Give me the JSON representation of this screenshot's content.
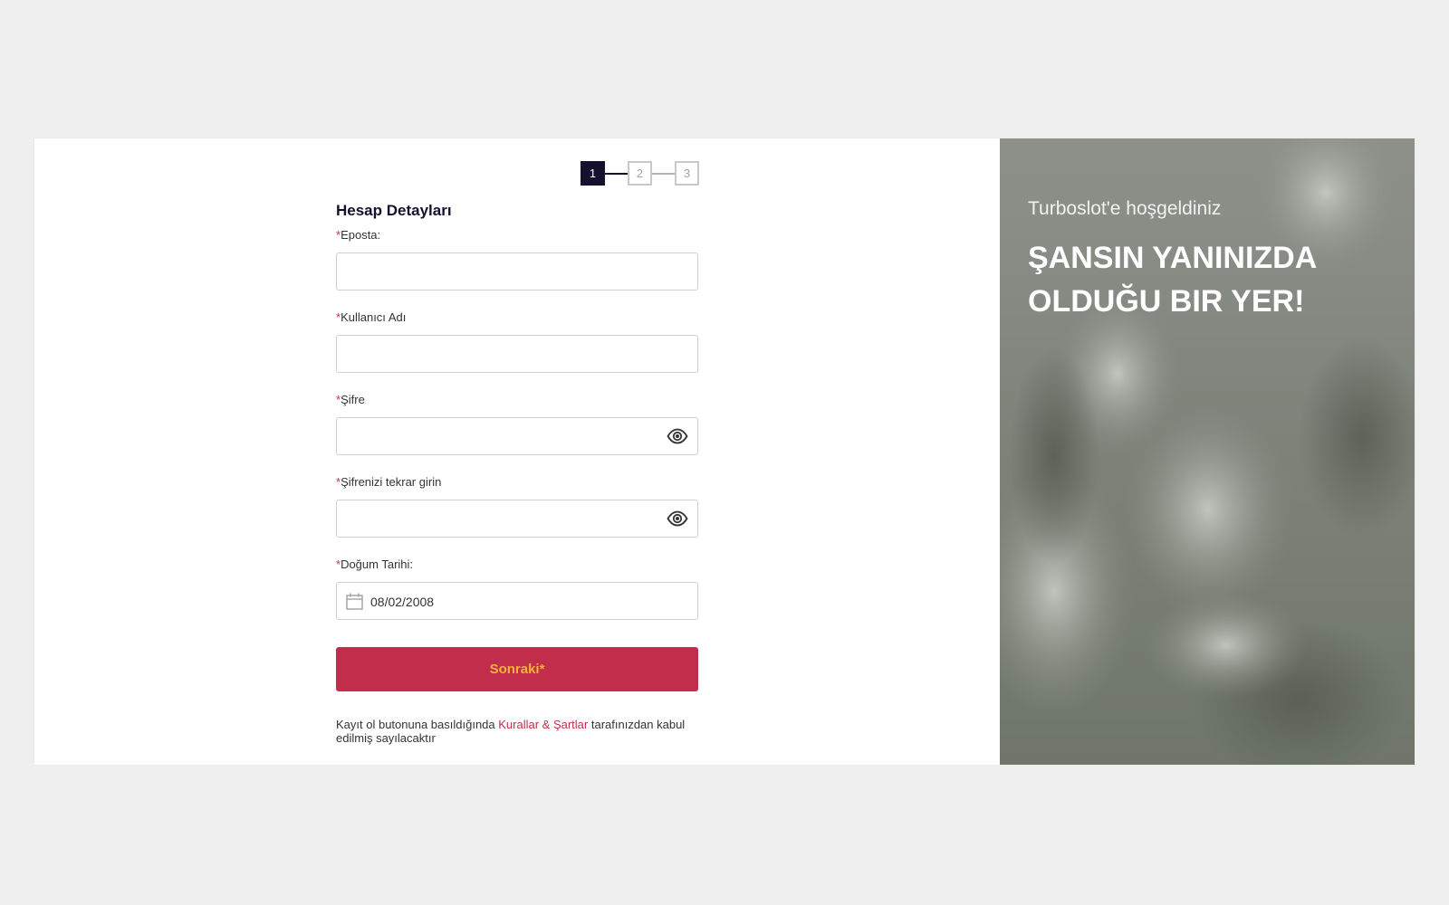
{
  "stepper": {
    "steps": [
      "1",
      "2",
      "3"
    ],
    "active_step": 1
  },
  "form": {
    "section_title": "Hesap Detayları",
    "required_marker": "*",
    "fields": {
      "email": {
        "label": "Eposta:",
        "value": ""
      },
      "username": {
        "label": "Kullanıcı Adı",
        "value": ""
      },
      "password": {
        "label": "Şifre",
        "value": "",
        "icon": "eye-icon"
      },
      "password_confirm": {
        "label": "Şifrenizi tekrar girin",
        "value": "",
        "icon": "eye-icon"
      },
      "birth_date": {
        "label": "Doğum Tarihi:",
        "value": "08/02/2008",
        "icon": "calendar-icon"
      }
    },
    "next_button_label": "Sonraki*",
    "terms": {
      "prefix": "Kayıt ol butonuna basıldığında ",
      "link": "Kurallar & Şartlar",
      "suffix": " tarafınızdan kabul edilmiş sayılacaktır"
    }
  },
  "hero": {
    "welcome": "Turboslot'e hoşgeldiniz",
    "headline": "ŞANSIN YANINIZDA OLDUĞU BIR YER!"
  },
  "colors": {
    "page_background": "#efefef",
    "step_active": "#14102e",
    "button_background": "#c12d4a",
    "button_text": "#f7b13a",
    "required_marker": "#c0304a",
    "link": "#c0304a"
  }
}
